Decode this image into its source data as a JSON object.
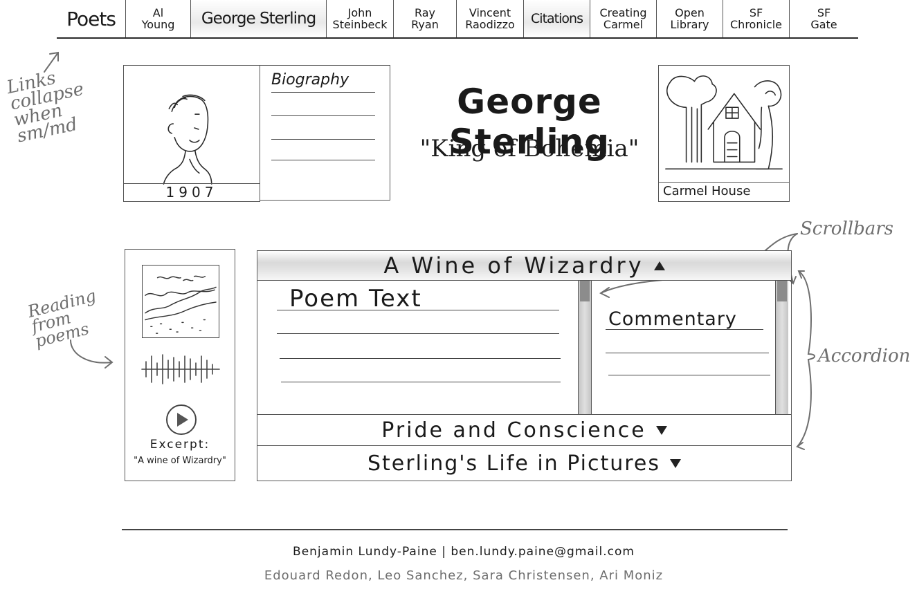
{
  "nav": {
    "brand": "Poets",
    "links": [
      {
        "label": "Al\nYoung"
      },
      {
        "label": "George Sterling"
      },
      {
        "label": "John\nSteinbeck"
      },
      {
        "label": "Ray\nRyan"
      },
      {
        "label": "Vincent\nRaodizzo"
      },
      {
        "label": "Citations"
      },
      {
        "label": "Creating\nCarmel"
      },
      {
        "label": "Open\nLibrary"
      },
      {
        "label": "SF\nChronicle"
      },
      {
        "label": "SF\nGate"
      }
    ]
  },
  "header": {
    "portrait_caption": "1907",
    "bio_title": "Biography",
    "title": "George Sterling",
    "subtitle": "\"King of Bohemia\"",
    "house_caption": "Carmel House"
  },
  "audio": {
    "excerpt_label": "Excerpt:",
    "excerpt_title": "\"A wine of Wizardry\""
  },
  "accordion": {
    "sections": [
      {
        "label": "A Wine of Wizardry",
        "state": "open"
      },
      {
        "label": "Pride and Conscience",
        "state": "collapsed"
      },
      {
        "label": "Sterling's Life in Pictures",
        "state": "collapsed"
      }
    ],
    "poem_title": "Poem Text",
    "commentary_title": "Commentary"
  },
  "annotations": {
    "links_note": "Links collapse when sm/md",
    "reading_note": "Reading from poems",
    "scrollbars_note": "Scrollbars",
    "accordion_note": "Accordion"
  },
  "footer": {
    "credit": "Benjamin Lundy-Paine | ben.lundy.paine@gmail.com",
    "contributors": "Edouard Redon, Leo Sanchez, Sara Christensen, Ari Moniz"
  },
  "colors": {
    "ink": "#1a1a1a",
    "pencil": "#6e6e6e",
    "header_fill": "#d9d9d9"
  }
}
